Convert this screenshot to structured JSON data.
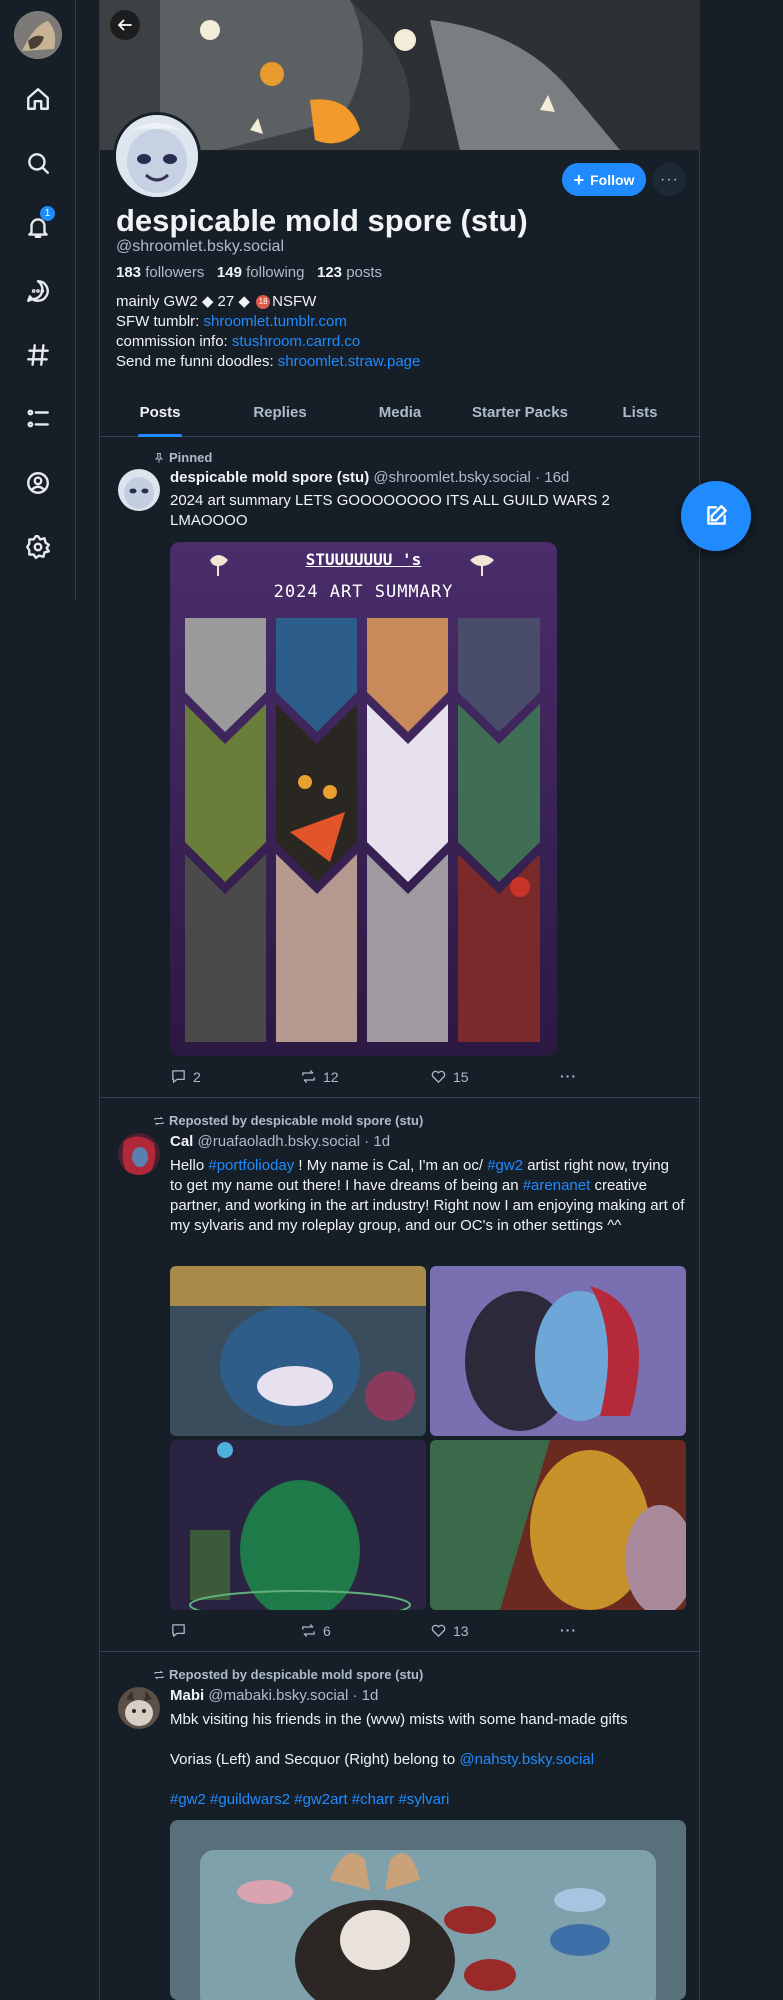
{
  "sidebar": {
    "notification_count": "1",
    "items": [
      {
        "icon": "home-icon"
      },
      {
        "icon": "search-icon"
      },
      {
        "icon": "bell-icon"
      },
      {
        "icon": "chat-icon"
      },
      {
        "icon": "hashtag-icon"
      },
      {
        "icon": "list-icon"
      },
      {
        "icon": "profile-icon"
      },
      {
        "icon": "settings-icon"
      }
    ]
  },
  "profile": {
    "display_name": "despicable mold spore (stu)",
    "handle": "@shroomlet.bsky.social",
    "followers_count": "183",
    "followers_label": "followers",
    "following_count": "149",
    "following_label": "following",
    "posts_count": "123",
    "posts_label": "posts",
    "bio_line1_a": "mainly GW2 ◆ 27 ◆ ",
    "bio_nsfw_badge": "18",
    "bio_line1_b": "NSFW",
    "bio_line2_prefix": "SFW tumblr: ",
    "bio_line2_link": "shroomlet.tumblr.com",
    "bio_line3_prefix": "commission info: ",
    "bio_line3_link": "stushroom.carrd.co",
    "bio_line4_prefix": "Send me funni doodles: ",
    "bio_line4_link": "shroomlet.straw.page",
    "follow_label": "Follow",
    "more_label": "···"
  },
  "tabs": [
    "Posts",
    "Replies",
    "Media",
    "Starter Packs",
    "Lists"
  ],
  "posts": [
    {
      "context": "Pinned",
      "author": "despicable mold spore (stu)",
      "handle": "@shroomlet.bsky.social",
      "time": "· 16d",
      "text": "2024 art summary LETS GOOOOOOOO ITS ALL GUILD WARS 2 LMAOOOO",
      "image_title1": "STUUUUUUU 's",
      "image_title2": "2024 ART SUMMARY",
      "replies": "2",
      "reposts": "12",
      "likes": "15"
    },
    {
      "context": "Reposted by despicable mold spore (stu)",
      "author": "Cal",
      "handle": "@ruafaoladh.bsky.social",
      "time": "· 1d",
      "text_parts": [
        "Hello ",
        "#portfolioday",
        " ! My name is Cal, I'm an oc/ ",
        "#gw2",
        " artist right now, trying to get my name out there! I have dreams of being an ",
        "#arenanet",
        " creative partner, and working in the art industry! Right now I am enjoying making art of my sylvaris and my roleplay group, and our OC's in other settings ^^"
      ],
      "replies": "",
      "reposts": "6",
      "likes": "13"
    },
    {
      "context": "Reposted by despicable mold spore (stu)",
      "author": "Mabi",
      "handle": "@mabaki.bsky.social",
      "time": "· 1d",
      "line1": "Mbk visiting his friends in the (wvw) mists with some hand-made gifts",
      "line2_prefix": "Vorias (Left) and Secquor (Right) belong to ",
      "line2_link": "@nahsty.bsky.social",
      "hashtags": "#gw2 #guildwars2 #gw2art #charr #sylvari"
    }
  ],
  "colors": {
    "background": "#161e27",
    "accent": "#208bfe",
    "border": "#2e4052",
    "muted_text": "#aebbc9"
  }
}
